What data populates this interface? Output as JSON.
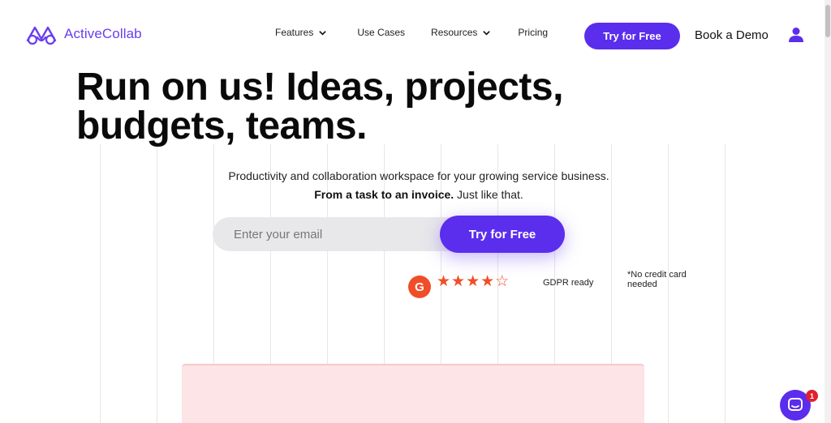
{
  "brand": {
    "name": "ActiveCollab",
    "color": "#6a3df0"
  },
  "nav": {
    "items": [
      {
        "label": "Features",
        "dropdown": true
      },
      {
        "label": "Use Cases",
        "dropdown": false
      },
      {
        "label": "Resources",
        "dropdown": true
      },
      {
        "label": "Pricing",
        "dropdown": false
      }
    ],
    "cta_label": "Try for Free",
    "demo_label": "Book a Demo",
    "user_icon": "user-icon"
  },
  "hero": {
    "headline_line1": "Run on us! Ideas, projects,",
    "headline_line2": "budgets, teams.",
    "subtitle": "Productivity and collaboration workspace for your growing service business.",
    "tagline_bold": "From a task to an invoice.",
    "tagline_rest": " Just like that.",
    "email_placeholder": "Enter your email",
    "cta_label": "Try for Free"
  },
  "trust": {
    "g2_badge": "G",
    "rating": 4.5,
    "stars": "★★★★☆",
    "gdpr": "GDPR ready",
    "no_card": "*No credit card needed"
  },
  "chat": {
    "badge_count": "1"
  },
  "colors": {
    "accent": "#5b2ded",
    "g2": "#f04e28",
    "preview_bg": "#fde4e6"
  }
}
